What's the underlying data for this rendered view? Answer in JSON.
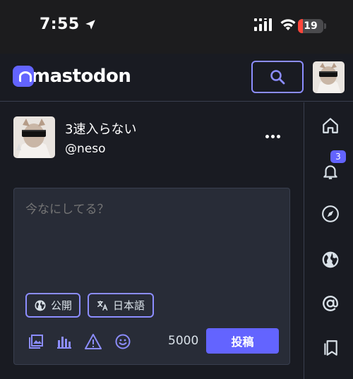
{
  "status_bar": {
    "time": "7:55",
    "battery_level": "19",
    "battery_fraction": 0.19,
    "battery_color": "#ff453a"
  },
  "header": {
    "logo_text": "mastodon",
    "brand_color": "#6364ff"
  },
  "account": {
    "display_name": "3速入らない",
    "handle": "@neso"
  },
  "compose": {
    "placeholder": "今なにしてる？",
    "visibility_label": "公開",
    "language_label": "日本語",
    "char_count": "5000",
    "post_label": "投稿"
  },
  "nav": {
    "notifications_count": "3",
    "items": [
      "home-icon",
      "bell-icon",
      "compass-icon",
      "globe-icon",
      "at-icon",
      "bookmark-icon"
    ]
  },
  "colors": {
    "accent": "#8c8dff",
    "background": "#191b22",
    "compose_bg": "#282c37"
  }
}
